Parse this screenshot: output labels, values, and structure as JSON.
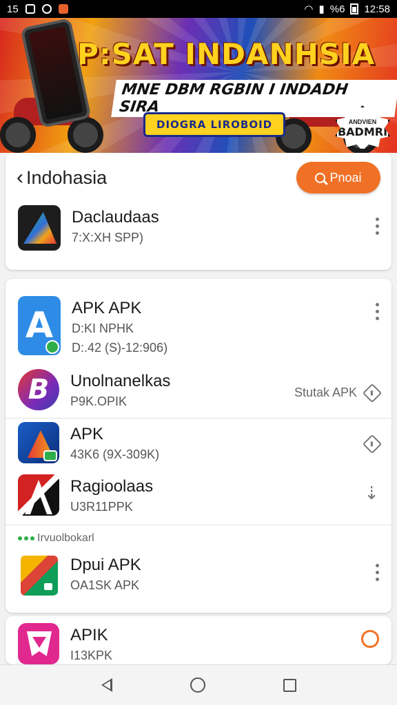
{
  "status_bar": {
    "time_left": "15",
    "percent": "%6",
    "clock": "12:58"
  },
  "banner": {
    "title": "P:SAT INDANHSIA",
    "subtitle": "MNE DBM RGBIN I INDADH SIRA",
    "button": "DIOGRA LIROBOID",
    "seal_top": "ANDVIEN",
    "seal_main": "BADMRI"
  },
  "header": {
    "title": "Indohasia",
    "search_label": "Pnoai"
  },
  "card1_app": {
    "name": "Daclaudaas",
    "meta": "7:X:XH SPP)",
    "icon": "green-orange-triangle"
  },
  "apps": [
    {
      "name": "APK APK",
      "meta1": "D:KI NPHK",
      "meta2": "D:.42 (S)-12:906)",
      "action": "more",
      "icon": "letter-a"
    },
    {
      "name": "Unolnanelkas",
      "meta1": "P9K.OPIK",
      "status": "Stutak APK",
      "action": "diamond",
      "icon": "letter-b"
    },
    {
      "name": "APK",
      "meta1": "43K6 (9X-309K)",
      "action": "diamond",
      "icon": "apk-triangle"
    },
    {
      "name": "Ragioolaas",
      "meta1": "U3R11PPK",
      "action": "download",
      "icon": "red-black-a"
    }
  ],
  "section": {
    "label": "Irvuolbokarl"
  },
  "section_apps": [
    {
      "name": "Dpui APK",
      "meta1": "OA1SK APK",
      "action": "more",
      "icon": "play-style"
    }
  ],
  "card3_app": {
    "name": "APIK",
    "meta1": "I13KPK",
    "action": "ring",
    "icon": "pink-shield"
  },
  "icons": {
    "back": "chevron-left",
    "more": "vertical-dots",
    "download": "download-arrow",
    "install": "diamond"
  },
  "colors": {
    "accent": "#f07126",
    "green": "#2eae4b"
  },
  "glyphs": {
    "chev": "‹",
    "download": "⇣",
    "letter_a": "A",
    "letter_b": "B"
  }
}
